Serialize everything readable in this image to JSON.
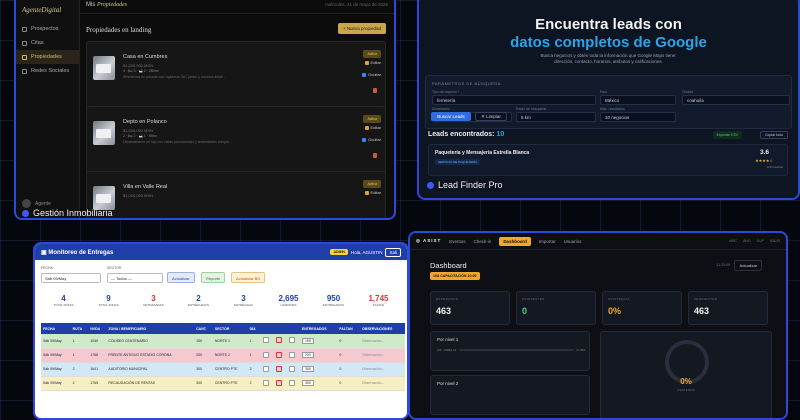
{
  "inmobiliaria": {
    "logo": "AgenteDigital",
    "nav": [
      "Prospectos",
      "Citas",
      "Propiedades",
      "Redes Sociales"
    ],
    "user": "Agente",
    "top_title_prefix": "Mis",
    "top_title_em": "Propiedades",
    "date": "miércoles, 21 de mayo de 2026",
    "section_title": "Propiedades en landing",
    "new_button": "+ Nueva propiedad",
    "badge": "Activa",
    "edit": "Editar",
    "hide": "Ocultar",
    "cards": [
      {
        "name": "Casa en Cumbres",
        "price": "$1,000,000 MXN",
        "meta": "4 · 🛏 3 · 🛁 2 · 280m²",
        "desc": "Residencia en privada con vigilancia 24h, jardín y cochera doble..."
      },
      {
        "name": "Depto en Polanco",
        "price": "$1,000,000 MXN",
        "meta": "2 · 🛏 2 · 🛁 1 · 95m²",
        "desc": "Departamento de lujo con vistas panorámicas y amenidades comple..."
      },
      {
        "name": "Villa en Valle Real",
        "price": "$1,000,000 MXN",
        "meta": "",
        "desc": ""
      }
    ],
    "tag": "Gestión Inmobiliaria"
  },
  "leadfinder": {
    "hero1": "Encuentra leads con",
    "hero2": "datos completos de Google",
    "sub1": "Busca negocios y obtén toda la información que Google Maps tiene:",
    "sub2": "dirección, contacto, horarios, atributos y calificaciones.",
    "form_title": "PARÁMETROS DE BÚSQUEDA",
    "labels": {
      "type": "Tipo de negocio *",
      "country": "País",
      "city": "Ciudad",
      "zone": "Zona/barrio",
      "radius": "Radio de búsqueda",
      "max": "Máx. resultados"
    },
    "values": {
      "type": "ferretería",
      "country": "México",
      "city": "coahuila",
      "zone": "torreon",
      "radius": "5 km",
      "max": "10 negocios"
    },
    "search": "Buscar Leads",
    "clear": "✕ Limpiar",
    "leads_label": "Leads encontrados:",
    "leads_count": "10",
    "export": "Exportar CSV",
    "copy": "Copiar todo",
    "lead": {
      "name": "Paquetería y Mensajería Estrella Blanca",
      "cat": "SERVICIO DE PAQUETERÍA",
      "rating": "3.6",
      "stars": "★★★★☆",
      "reviews": "129 reseñas"
    },
    "tag": "Lead Finder Pro"
  },
  "monitoreo": {
    "title": "Monitoreo de Entregas",
    "admin": "ADMIN",
    "user": "Hola, AGUSTIN",
    "logout": "Sali",
    "f_fecha": "FECHA",
    "v_fecha": "Sáb 09/May",
    "f_sector": "SECTOR",
    "v_sector": "— Todos —",
    "b_actualizar": "Actualizar",
    "b_reporte": "Reporte",
    "b_bd": "Actualizar BD",
    "stats": [
      {
        "v": "4",
        "l": "TOTAL RUTAS",
        "c": "#1f3fa8"
      },
      {
        "v": "9",
        "l": "TOTAL ZONAS",
        "c": "#1f3fa8"
      },
      {
        "v": "3",
        "l": "RETRASADAS",
        "c": "#d33"
      },
      {
        "v": "2",
        "l": "ENTREGADOS",
        "c": "#1f3fa8"
      },
      {
        "v": "3",
        "l": "ENTREGADO",
        "c": "#1f3fa8"
      },
      {
        "v": "2,695",
        "l": "CAMIONES",
        "c": "#1f3fa8"
      },
      {
        "v": "950",
        "l": "ENTREGADOS",
        "c": "#1f3fa8"
      },
      {
        "v": "1,745",
        "l": "FALTAN",
        "c": "#d33"
      }
    ],
    "headers": [
      "FECHA",
      "RUTA",
      "NVDA",
      "ZONA / BENEFICIARIO",
      "CANT.",
      "SECTOR",
      "DÍA",
      "",
      "",
      "",
      "ENTREGADOS",
      "FALTAN",
      "OBSERVACIONES"
    ],
    "rows": [
      {
        "fecha": "Sáb 09/May",
        "ruta": "1",
        "nvda": "1040",
        "zona": "COLISEO CENTENARIO",
        "cant": "150",
        "sector": "NORTE 1",
        "dia": "1",
        "ent": "150",
        "faltan": "0",
        "obs": "Observación...",
        "bg": "#cfe9c9"
      },
      {
        "fecha": "Sáb 09/May",
        "ruta": "1",
        "nvda": "1768",
        "zona": "FRENTE ANTIGUO ESTADIO CORONA",
        "cant": "200",
        "sector": "NORTE 2",
        "dia": "1",
        "ent": "200",
        "faltan": "0",
        "obs": "Observación...",
        "bg": "#f4c9cf"
      },
      {
        "fecha": "Sáb 09/May",
        "ruta": "2",
        "nvda": "1641",
        "zona": "AUDITORIO MUNICIPAL",
        "cant": "300",
        "sector": "CENTRO PTE",
        "dia": "2",
        "ent": "300",
        "faltan": "0",
        "obs": "Observación...",
        "bg": "#d2e8f6"
      },
      {
        "fecha": "Sáb 09/May",
        "ruta": "2",
        "nvda": "1765",
        "zona": "RECAUDACIÓN DE RENTAS",
        "cant": "300",
        "sector": "CENTRO PTE",
        "dia": "2",
        "ent": "300",
        "faltan": "0",
        "obs": "Observación...",
        "bg": "#f7efc4"
      }
    ]
  },
  "asist": {
    "brand": "ASIST",
    "tabs": [
      "Eventos",
      "Check-in",
      "Dashboard",
      "Importar",
      "Usuarios"
    ],
    "active_tab": "Dashboard",
    "top_right": [
      "MBC",
      "ANG",
      "SUP",
      "SALIR"
    ],
    "dashboard": "Dashboard",
    "cap": "10A CAPACITACIÓN 10:00",
    "clock": "21:30:09",
    "refresh": "Actualizar",
    "kpis": [
      {
        "l": "ESPERADOS",
        "v": "463",
        "c": "#f2f2f2"
      },
      {
        "l": "ASISTENTES",
        "v": "0",
        "c": "#3fd08a"
      },
      {
        "l": "ASISTENCIA",
        "v": "0%",
        "c": "#f2a72a"
      },
      {
        "l": "PENDIENTES",
        "v": "463",
        "c": "#f2f2f2"
      }
    ],
    "levels": [
      {
        "t": "Por nivel 1",
        "row": "0/A · ANDA 21",
        "n": "0/ 384"
      },
      {
        "t": "Por nivel 2",
        "row": "",
        "n": ""
      }
    ],
    "pct": "0%",
    "pct_label": "ASISTENCIA"
  },
  "colors": {
    "accent": "#2a4ad8",
    "gold": "#c9a646",
    "orange": "#f2a72a",
    "cyan": "#2aa6e8"
  }
}
